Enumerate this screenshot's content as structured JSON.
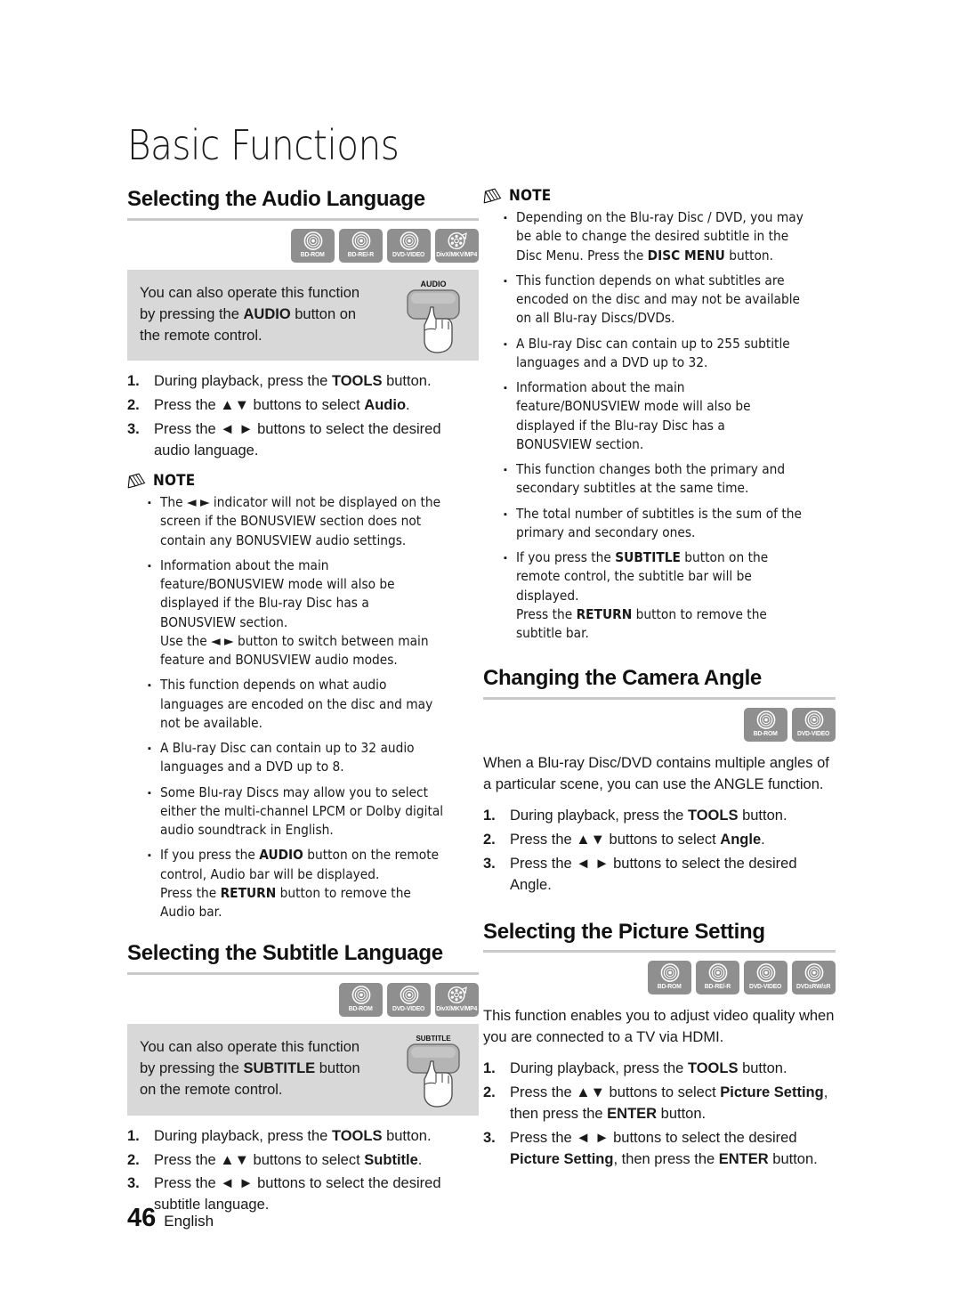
{
  "chapter": {
    "title": "Basic Functions"
  },
  "footer": {
    "page_number": "46",
    "language": "English"
  },
  "note_label": "NOTE",
  "badges": {
    "bd_rom": "BD-ROM",
    "bd_re_r": "BD-RE/-R",
    "dvd_video": "DVD-VIDEO",
    "divx": "DivX/MKV/MP4",
    "dvd_rw_r": "DVD±RW/±R"
  },
  "sections": {
    "audio_language": {
      "heading": "Selecting the Audio Language",
      "badges": [
        "BD-ROM",
        "BD-RE/-R",
        "DVD-VIDEO",
        "DivX/MKV/MP4"
      ],
      "badge_types": [
        "disc",
        "disc",
        "disc",
        "film"
      ],
      "tip": {
        "text_before": "You can also operate this function by pressing the ",
        "bold": "AUDIO",
        "text_after": " button on the remote control.",
        "remote_button_label": "AUDIO"
      },
      "steps": [
        {
          "num": "1.",
          "before": "During playback, press the ",
          "bold": "TOOLS",
          "after": " button."
        },
        {
          "num": "2.",
          "before": "Press the ▲▼ buttons to select ",
          "bold": "Audio",
          "after": "."
        },
        {
          "num": "3.",
          "before": "Press the ◄ ► buttons to select the desired audio language.",
          "bold": "",
          "after": ""
        }
      ],
      "notes": [
        "The ◄ ► indicator will not be displayed on the screen if the BONUSVIEW section does not contain any BONUSVIEW audio settings.",
        "Information about the main feature/BONUSVIEW mode will also be displayed if the Blu-ray Disc has a BONUSVIEW section.\nUse the ◄ ► button to switch between main feature and BONUSVIEW audio modes.",
        "This function depends on what audio languages are encoded on the disc and may not be available.",
        "A Blu-ray Disc can contain up to 32 audio languages and a DVD up to 8.",
        "Some Blu-ray Discs may allow you to select either the multi-channel LPCM or Dolby digital audio soundtrack in English."
      ],
      "note_last": {
        "p1_before": "If you press the ",
        "p1_bold": "AUDIO",
        "p1_after": " button on the remote control, Audio bar will be displayed.",
        "p2_before": "Press the ",
        "p2_bold": "RETURN",
        "p2_after": " button to remove the Audio bar."
      }
    },
    "subtitle_language": {
      "heading": "Selecting the Subtitle Language",
      "badges": [
        "BD-ROM",
        "DVD-VIDEO",
        "DivX/MKV/MP4"
      ],
      "badge_types": [
        "disc",
        "disc",
        "film"
      ],
      "tip": {
        "text_before": "You can also operate this function by pressing the ",
        "bold": "SUBTITLE",
        "text_after": " button on the remote control.",
        "remote_button_label": "SUBTITLE"
      },
      "steps": [
        {
          "num": "1.",
          "before": "During playback, press the ",
          "bold": "TOOLS",
          "after": " button."
        },
        {
          "num": "2.",
          "before": "Press the ▲▼ buttons to select ",
          "bold": "Subtitle",
          "after": "."
        },
        {
          "num": "3.",
          "before": "Press the ◄ ► buttons to select the desired subtitle language.",
          "bold": "",
          "after": ""
        }
      ]
    },
    "subtitle_notes": {
      "note_first": {
        "before": "Depending on the Blu-ray Disc / DVD, you may be able to change the desired subtitle in the Disc Menu. Press the ",
        "bold": "DISC MENU",
        "after": " button."
      },
      "notes": [
        "This function depends on what subtitles are encoded on the disc and may not be available on all Blu-ray Discs/DVDs.",
        "A Blu-ray Disc can contain up to 255 subtitle languages and a DVD up to 32.",
        "Information about the main feature/BONUSVIEW mode will also be displayed if the Blu-ray Disc has a BONUSVIEW section.",
        "This function changes both the primary and secondary subtitles at the same time.",
        "The total number of subtitles is the sum of the primary and secondary ones."
      ],
      "note_last": {
        "p1_before": "If you press the ",
        "p1_bold": "SUBTITLE",
        "p1_after": " button on the remote control, the subtitle bar will be displayed.",
        "p2_before": "Press the ",
        "p2_bold": "RETURN",
        "p2_after": " button to remove the subtitle bar."
      }
    },
    "camera_angle": {
      "heading": "Changing the Camera Angle",
      "badges": [
        "BD-ROM",
        "DVD-VIDEO"
      ],
      "badge_types": [
        "disc",
        "disc"
      ],
      "paragraph": "When a Blu-ray Disc/DVD contains multiple angles of a particular scene, you can use the ANGLE function.",
      "steps": [
        {
          "num": "1.",
          "before": "During playback, press the ",
          "bold": "TOOLS",
          "after": " button."
        },
        {
          "num": "2.",
          "before": "Press the ▲▼ buttons to select ",
          "bold": "Angle",
          "after": "."
        },
        {
          "num": "3.",
          "before": "Press the ◄ ► buttons to select the desired Angle.",
          "bold": "",
          "after": ""
        }
      ]
    },
    "picture_setting": {
      "heading": "Selecting the Picture Setting",
      "badges": [
        "BD-ROM",
        "BD-RE/-R",
        "DVD-VIDEO",
        "DVD±RW/±R"
      ],
      "badge_types": [
        "disc",
        "disc",
        "disc",
        "disc"
      ],
      "paragraph": "This function enables you to adjust video quality when you are connected to a TV via HDMI.",
      "step1": {
        "num": "1.",
        "before": "During playback, press the ",
        "bold": "TOOLS",
        "after": " button."
      },
      "step2": {
        "num": "2.",
        "before": "Press the ▲▼ buttons to select ",
        "bold1": "Picture Setting",
        "mid": ", then press the ",
        "bold2": "ENTER",
        "after": " button."
      },
      "step3": {
        "num": "3.",
        "before": "Press the ◄ ► buttons to select the desired ",
        "bold1": "Picture Setting",
        "mid": ", then press the ",
        "bold2": "ENTER",
        "after": " button."
      }
    }
  }
}
